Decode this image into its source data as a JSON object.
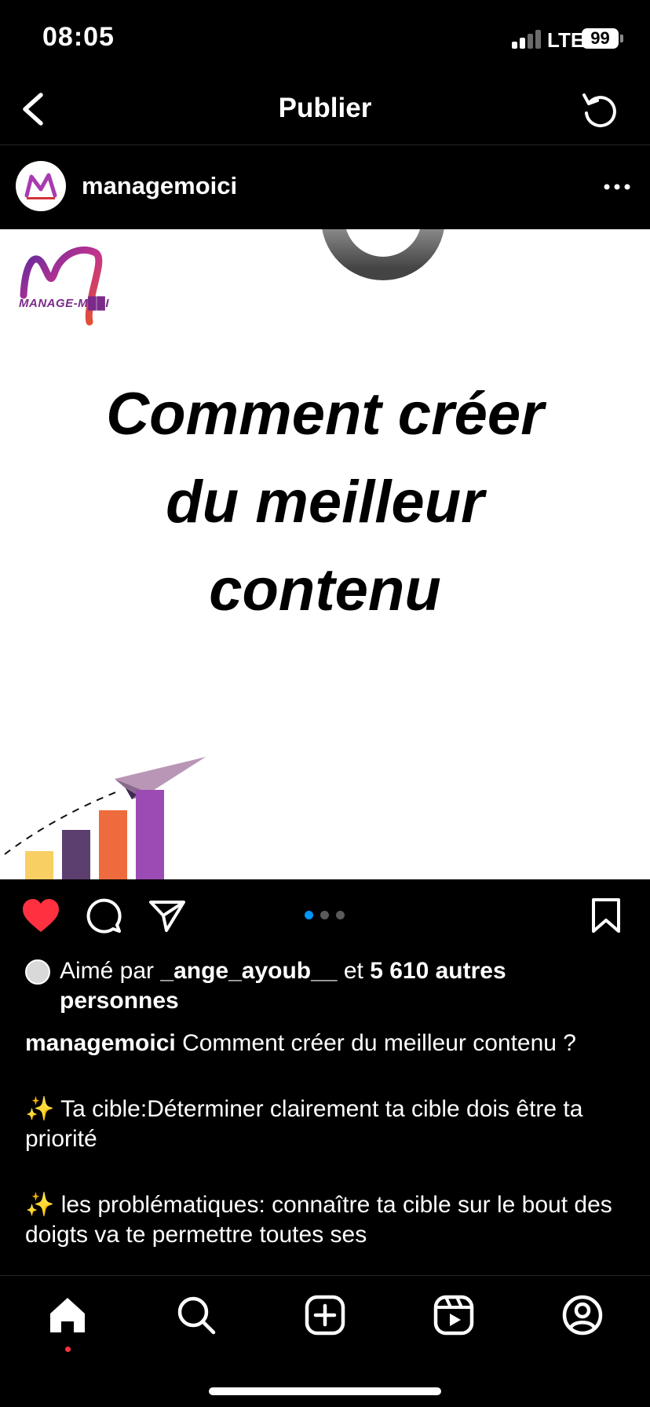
{
  "status_bar": {
    "time": "08:05",
    "network": "LTE",
    "battery": "99"
  },
  "header": {
    "title": "Publier",
    "back_icon": "chevron-left-icon",
    "refresh_icon": "refresh-icon"
  },
  "post": {
    "username": "managemoici",
    "more_icon": "more-horizontal-icon",
    "image": {
      "brand": "MANAGE-M██I",
      "headline_lines": [
        "Comment créer",
        "du meilleur",
        "contenu"
      ]
    },
    "carousel": {
      "count": 3,
      "active_index": 0
    },
    "likes": {
      "prefix": "Aimé par ",
      "user": "_ange_ayoub__",
      "middle": " et ",
      "count_text": "5 610 autres personnes"
    },
    "caption": {
      "user": "managemoici",
      "lines": [
        "Comment créer du meilleur contenu ?",
        "✨ Ta cible:Déterminer clairement ta cible dois être ta priorité",
        "✨ les problématiques: connaître ta cible sur le bout des doigts va te permettre toutes ses"
      ]
    }
  },
  "colors": {
    "like_red": "#ff3040",
    "active_dot": "#0095f6",
    "background": "#000000"
  },
  "tab_bar": {
    "items": [
      "home-icon",
      "search-icon",
      "create-icon",
      "reels-icon",
      "profile-icon"
    ],
    "active": "home-icon"
  }
}
